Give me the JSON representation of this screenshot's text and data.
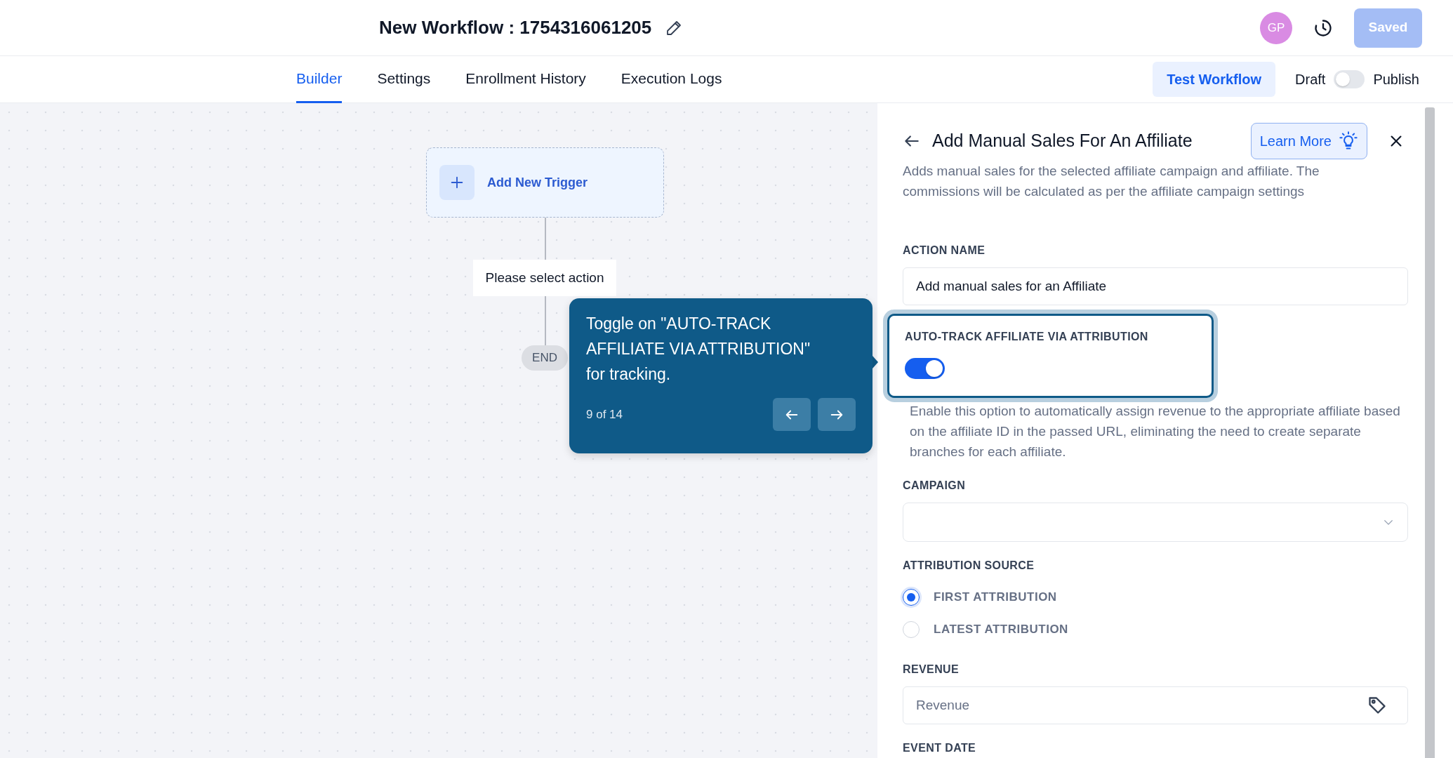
{
  "header": {
    "title": "New Workflow : 1754316061205",
    "avatar_initials": "GP",
    "save_button": {
      "label": "Saved",
      "disabled": true
    }
  },
  "tabs": [
    {
      "label": "Builder",
      "selected": true
    },
    {
      "label": "Settings",
      "selected": false
    },
    {
      "label": "Enrollment History",
      "selected": false
    },
    {
      "label": "Execution Logs",
      "selected": false
    }
  ],
  "test_button": "Test Workflow",
  "publish_toggle": {
    "off_label": "Draft",
    "on_label": "Publish",
    "on": false
  },
  "canvas": {
    "trigger": "Add New Trigger",
    "action_placeholder": "Please select action",
    "end": "END"
  },
  "tour": {
    "text": "Toggle on \"AUTO-TRACK AFFILIATE VIA ATTRIBUTION\" for tracking.",
    "step": "9 of 14"
  },
  "panel": {
    "title": "Add Manual Sales For An Affiliate",
    "learn_more": "Learn More",
    "description": "Adds manual sales for the selected affiliate campaign and affiliate. The commissions will be calculated as per the affiliate campaign settings",
    "fields": [
      {
        "kind": "text",
        "label": "ACTION NAME",
        "value": "Add manual sales for an Affiliate"
      },
      {
        "kind": "toggle",
        "label": "AUTO-TRACK AFFILIATE VIA ATTRIBUTION",
        "on": true,
        "highlighted": true,
        "help": "Enable this option to automatically assign revenue to the appropriate affiliate based on the affiliate ID in the passed URL, eliminating the need to create separate branches for each affiliate."
      },
      {
        "kind": "select",
        "label": "CAMPAIGN"
      },
      {
        "kind": "radio",
        "label": "ATTRIBUTION SOURCE",
        "options": [
          {
            "label": "FIRST ATTRIBUTION",
            "selected": true
          },
          {
            "label": "LATEST ATTRIBUTION",
            "selected": false
          }
        ]
      },
      {
        "kind": "text",
        "label": "REVENUE",
        "placeholder": "Revenue",
        "tag_icon": true
      },
      {
        "kind": "heading",
        "label": "EVENT DATE"
      }
    ]
  }
}
